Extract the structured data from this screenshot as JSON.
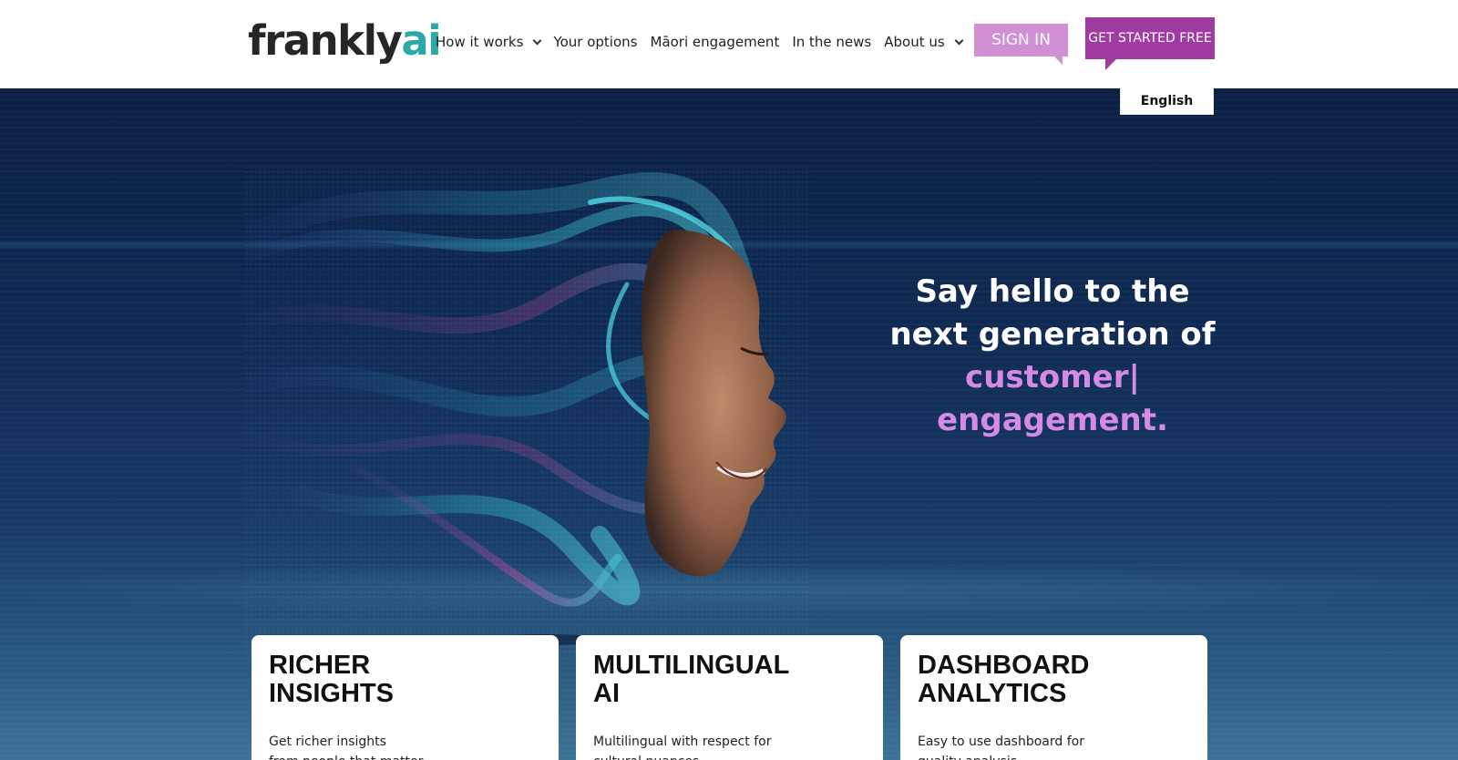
{
  "header": {
    "logo_main": "frankly",
    "logo_accent": "ai",
    "nav": [
      {
        "label": "How it works",
        "has_dropdown": true
      },
      {
        "label": "Your options",
        "has_dropdown": false
      },
      {
        "label": "Māori engagement",
        "has_dropdown": false
      },
      {
        "label": "In the news",
        "has_dropdown": false
      },
      {
        "label": "About us",
        "has_dropdown": true
      }
    ],
    "sign_in": "SIGN IN",
    "get_started": "GET STARTED FREE",
    "language": "English"
  },
  "hero": {
    "line1": "Say hello to the",
    "line2": "next generation of",
    "accent1": "customer|",
    "accent2": "engagement."
  },
  "cards": [
    {
      "title": "RICHER\nINSIGHTS",
      "text": "Get richer insights\nfrom people that matter"
    },
    {
      "title": "MULTILINGUAL\nAI",
      "text": "Multilingual with respect for\ncultural nuances"
    },
    {
      "title": "DASHBOARD\nANALYTICS",
      "text": "Easy to use dashboard for\nquality analysis"
    }
  ],
  "colors": {
    "brand_teal": "#29a9a8",
    "sign_in_bg": "#d18fd4",
    "get_started_bg": "#a03ca1",
    "headline_accent": "#d58ae6",
    "hero_bg": "#0f2a52"
  }
}
